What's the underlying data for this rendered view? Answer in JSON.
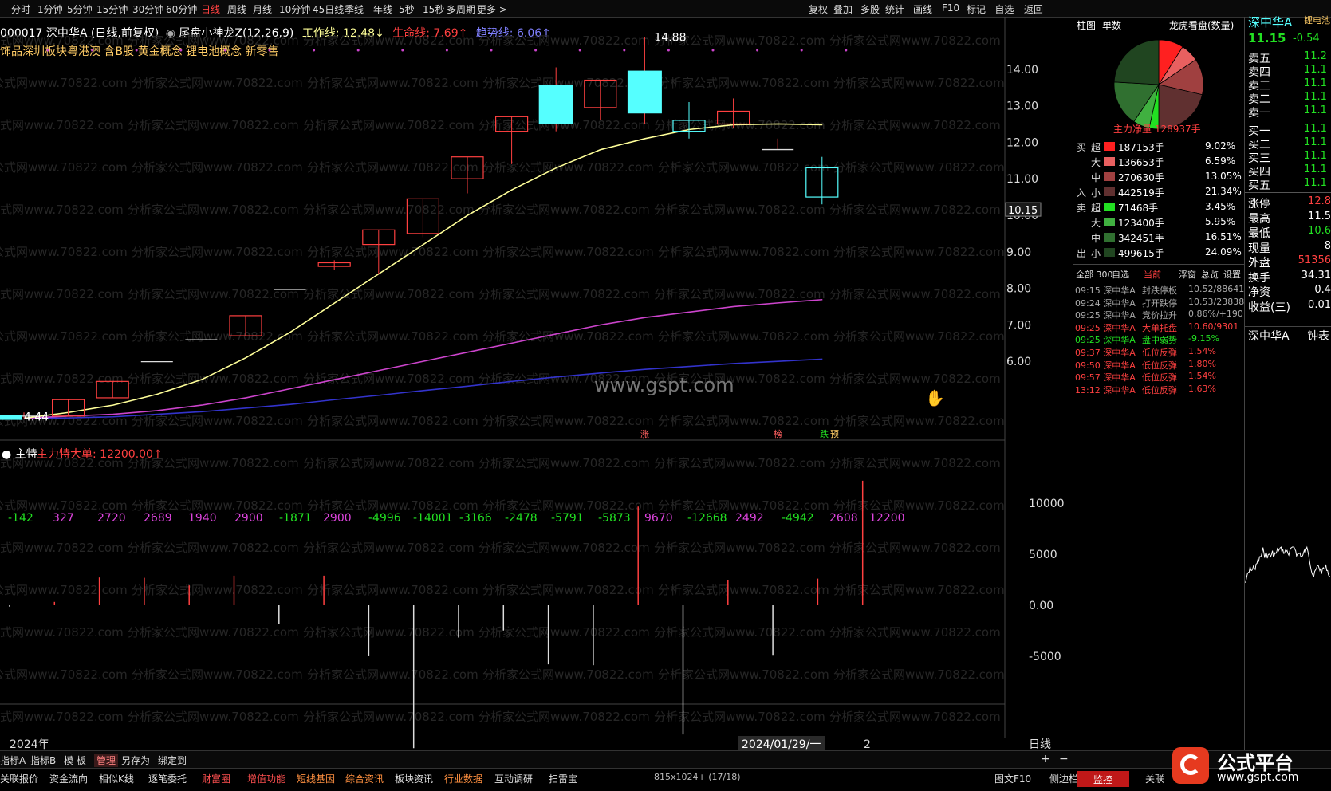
{
  "topbar": {
    "items": [
      "分时",
      "1分钟",
      "5分钟",
      "15分钟",
      "30分钟",
      "60分钟",
      "日线",
      "周线",
      "月线",
      "10分钟",
      "45日线",
      "季线",
      "年线",
      "5秒",
      "15秒",
      "多周期",
      "更多 >"
    ],
    "active": "日线",
    "right_items": [
      "复权",
      "叠加",
      "多股",
      "统计",
      "画线",
      "F10",
      "标记",
      "-自选",
      "返回"
    ]
  },
  "chart": {
    "header": {
      "code_name": "000017 深中华A (日线,前复权)",
      "indicator": "尾盘小神龙Z(12,26,9)",
      "work_line": "工作线: 12.48↓",
      "life_line": "生命线: 7.69↑",
      "trend_line": "趋势线: 6.06↑"
    },
    "concepts": "饰品深圳板块粤港澳 含B股 黄金概念 锂电池概念 新零售",
    "price_labels": [
      "14.00",
      "13.00",
      "12.00",
      "11.00",
      "10.00",
      "9.00",
      "8.00",
      "7.00",
      "6.00"
    ],
    "current_price": "10.15",
    "high_label": "14.88",
    "low_label": "4.44",
    "watermark": "www.gspt.com",
    "watermark_rep": "分析家公式网www.70822.com",
    "markers": [
      "涨",
      "榜",
      "跌"
    ],
    "marker_tag": "预",
    "volume_header": "主特",
    "volume_title": "主力特大单: 12200.00↑",
    "volume_values": [
      "-142",
      "327",
      "2720",
      "2689",
      "1940",
      "2900",
      "-1871",
      "2900",
      "-4996",
      "-14001",
      "-3166",
      "-2478",
      "-5791",
      "-5873",
      "9670",
      "-12668",
      "2492",
      "-4942",
      "2608",
      "12200"
    ],
    "volume_axis": [
      "10000",
      "5000",
      "0.00",
      "-5000"
    ],
    "year_label": "2024年",
    "date_label": "2024/01/29/一",
    "date_num": "2",
    "period_label": "日线"
  },
  "chart_data": {
    "type": "candlestick",
    "candles": [
      {
        "o": 4.5,
        "c": 4.5,
        "h": 4.6,
        "l": 4.44
      },
      {
        "o": 4.5,
        "c": 4.95,
        "h": 4.95,
        "l": 4.5
      },
      {
        "o": 5.0,
        "c": 5.45,
        "h": 5.45,
        "l": 5.0
      },
      {
        "o": 5.99,
        "c": 5.99,
        "h": 5.99,
        "l": 5.99
      },
      {
        "o": 6.59,
        "c": 6.59,
        "h": 6.59,
        "l": 6.59
      },
      {
        "o": 6.7,
        "c": 7.25,
        "h": 7.25,
        "l": 6.7
      },
      {
        "o": 7.97,
        "c": 7.97,
        "h": 7.97,
        "l": 7.97
      },
      {
        "o": 8.6,
        "c": 8.7,
        "h": 8.77,
        "l": 8.5
      },
      {
        "o": 9.2,
        "c": 9.6,
        "h": 9.6,
        "l": 8.4
      },
      {
        "o": 9.5,
        "c": 10.45,
        "h": 10.45,
        "l": 9.4
      },
      {
        "o": 11.0,
        "c": 11.6,
        "h": 11.6,
        "l": 10.6
      },
      {
        "o": 12.3,
        "c": 12.7,
        "h": 12.7,
        "l": 11.4
      },
      {
        "o": 12.5,
        "c": 13.55,
        "h": 14.05,
        "l": 12.3
      },
      {
        "o": 12.95,
        "c": 13.7,
        "h": 13.7,
        "l": 12.6
      },
      {
        "o": 12.8,
        "c": 13.95,
        "h": 14.88,
        "l": 12.5
      },
      {
        "o": 12.6,
        "c": 12.3,
        "h": 13.1,
        "l": 12.1
      },
      {
        "o": 12.5,
        "c": 12.85,
        "h": 13.2,
        "l": 12.4
      },
      {
        "o": 11.8,
        "c": 11.8,
        "h": 12.1,
        "l": 11.8
      },
      {
        "o": 11.3,
        "c": 10.5,
        "h": 11.6,
        "l": 10.3
      }
    ],
    "work_line": [
      4.44,
      4.6,
      4.8,
      5.1,
      5.5,
      6.1,
      6.8,
      7.6,
      8.4,
      9.2,
      10.0,
      10.7,
      11.3,
      11.8,
      12.1,
      12.35,
      12.48,
      12.5,
      12.48
    ],
    "life_line": [
      4.44,
      4.5,
      4.55,
      4.65,
      4.8,
      5.0,
      5.25,
      5.5,
      5.75,
      6.0,
      6.25,
      6.5,
      6.75,
      7.0,
      7.2,
      7.35,
      7.5,
      7.6,
      7.69
    ],
    "trend_line": [
      4.44,
      4.45,
      4.48,
      4.55,
      4.62,
      4.72,
      4.82,
      4.95,
      5.07,
      5.2,
      5.32,
      5.45,
      5.57,
      5.68,
      5.78,
      5.86,
      5.94,
      6.0,
      6.06
    ],
    "volumes": [
      -142,
      327,
      2720,
      2689,
      1940,
      2900,
      -1871,
      2900,
      -4996,
      -14001,
      -3166,
      -2478,
      -5791,
      -5873,
      9670,
      -12668,
      2492,
      -4942,
      2608,
      12200
    ],
    "ylim_price": [
      4.3,
      15.0
    ],
    "ylim_vol": [
      -14001,
      12200
    ]
  },
  "side": {
    "tabs": [
      "柱图",
      "单数",
      "龙虎看盘(数量)"
    ],
    "pie_title": "主力净量 128937手",
    "buy_group": "买",
    "sell_group": "卖",
    "buy_in": "入",
    "sell_out": "出",
    "rows": [
      {
        "g": "买",
        "k": "超",
        "v": "187153手",
        "p": "9.02%",
        "c": "#ff2020"
      },
      {
        "g": "",
        "k": "大",
        "v": "136653手",
        "p": "6.59%",
        "c": "#e86060"
      },
      {
        "g": "",
        "k": "中",
        "v": "270630手",
        "p": "13.05%",
        "c": "#a04040"
      },
      {
        "g": "入",
        "k": "小",
        "v": "442519手",
        "p": "21.34%",
        "c": "#603030"
      },
      {
        "g": "卖",
        "k": "超",
        "v": "71468手",
        "p": "3.45%",
        "c": "#22e022"
      },
      {
        "g": "",
        "k": "大",
        "v": "123400手",
        "p": "5.95%",
        "c": "#40b040"
      },
      {
        "g": "",
        "k": "中",
        "v": "342451手",
        "p": "16.51%",
        "c": "#307030"
      },
      {
        "g": "出",
        "k": "小",
        "v": "499615手",
        "p": "24.09%",
        "c": "#204520"
      }
    ],
    "news_tabs": [
      "全部 300",
      "自选",
      "当前",
      "浮窗",
      "总览",
      "设置"
    ],
    "news": [
      {
        "t": "09:15 深中华A",
        "e": "封跌停板",
        "d": "10.52/88641",
        "c": "#aaaaaa"
      },
      {
        "t": "09:24 深中华A",
        "e": "打开跌停",
        "d": "10.53/23838",
        "c": "#aaaaaa"
      },
      {
        "t": "09:25 深中华A",
        "e": "竞价拉升",
        "d": "0.86%/+190",
        "c": "#aaaaaa"
      },
      {
        "t": "09:25 深中华A",
        "e": "大单托盘",
        "d": "10.60/9301",
        "c": "#ff4040"
      },
      {
        "t": "09:25 深中华A",
        "e": "盘中弱势",
        "d": "-9.15%",
        "c": "#22e022"
      },
      {
        "t": "09:37 深中华A",
        "e": "低位反弹",
        "d": "1.54%",
        "c": "#ff4040"
      },
      {
        "t": "09:50 深中华A",
        "e": "低位反弹",
        "d": "1.80%",
        "c": "#ff4040"
      },
      {
        "t": "09:57 深中华A",
        "e": "低位反弹",
        "d": "1.54%",
        "c": "#ff4040"
      },
      {
        "t": "13:12 深中华A",
        "e": "低位反弹",
        "d": "1.63%",
        "c": "#ff4040"
      }
    ]
  },
  "far": {
    "title": "深中华A",
    "tag": "锂电池",
    "price": "11.15",
    "change": "-0.54",
    "asks": [
      "卖五",
      "卖四",
      "卖三",
      "卖二",
      "卖一"
    ],
    "bids": [
      "买一",
      "买二",
      "买三",
      "买四",
      "买五"
    ],
    "ask_vals": [
      "11.2",
      "11.1",
      "11.1",
      "11.1",
      "11.1"
    ],
    "bid_vals": [
      "11.1",
      "11.1",
      "11.1",
      "11.1",
      "11.1"
    ],
    "stats": [
      {
        "k": "涨停",
        "v": "12.8"
      },
      {
        "k": "最高",
        "v": "11.5"
      },
      {
        "k": "最低",
        "v": "10.6"
      },
      {
        "k": "现量",
        "v": "8"
      },
      {
        "k": "外盘",
        "v": "51356"
      },
      {
        "k": "换手",
        "v": "34.31"
      },
      {
        "k": "净资",
        "v": "0.4"
      },
      {
        "k": "收益(三)",
        "v": "0.01"
      }
    ],
    "mini_title": "深中华A",
    "mini_tab": "钟表"
  },
  "bottom": {
    "row1": [
      "指标A",
      "指标B",
      "模 板",
      "管理",
      "另存为",
      "绑定到"
    ],
    "row1_active": "管理",
    "row2": [
      "关联报价",
      "资金流向",
      "相似K线",
      "逐笔委托",
      "财富圈",
      "增值功能",
      "短线基因",
      "综合资讯",
      "板块资讯",
      "行业数据",
      "互动调研",
      "扫雷宝"
    ],
    "status": "815x1024+ (17/18)",
    "right": [
      "图文F10",
      "侧边栏"
    ],
    "monitor": "监控",
    "link": "关联"
  },
  "logo": {
    "text": "公式平台",
    "url_text": "www.gspt.com"
  },
  "colors": {
    "up": "#ff4040",
    "down": "#55ffff",
    "work": "#ffff99",
    "life": "#cc44cc",
    "trend": "#3333cc",
    "green": "#22e022"
  }
}
